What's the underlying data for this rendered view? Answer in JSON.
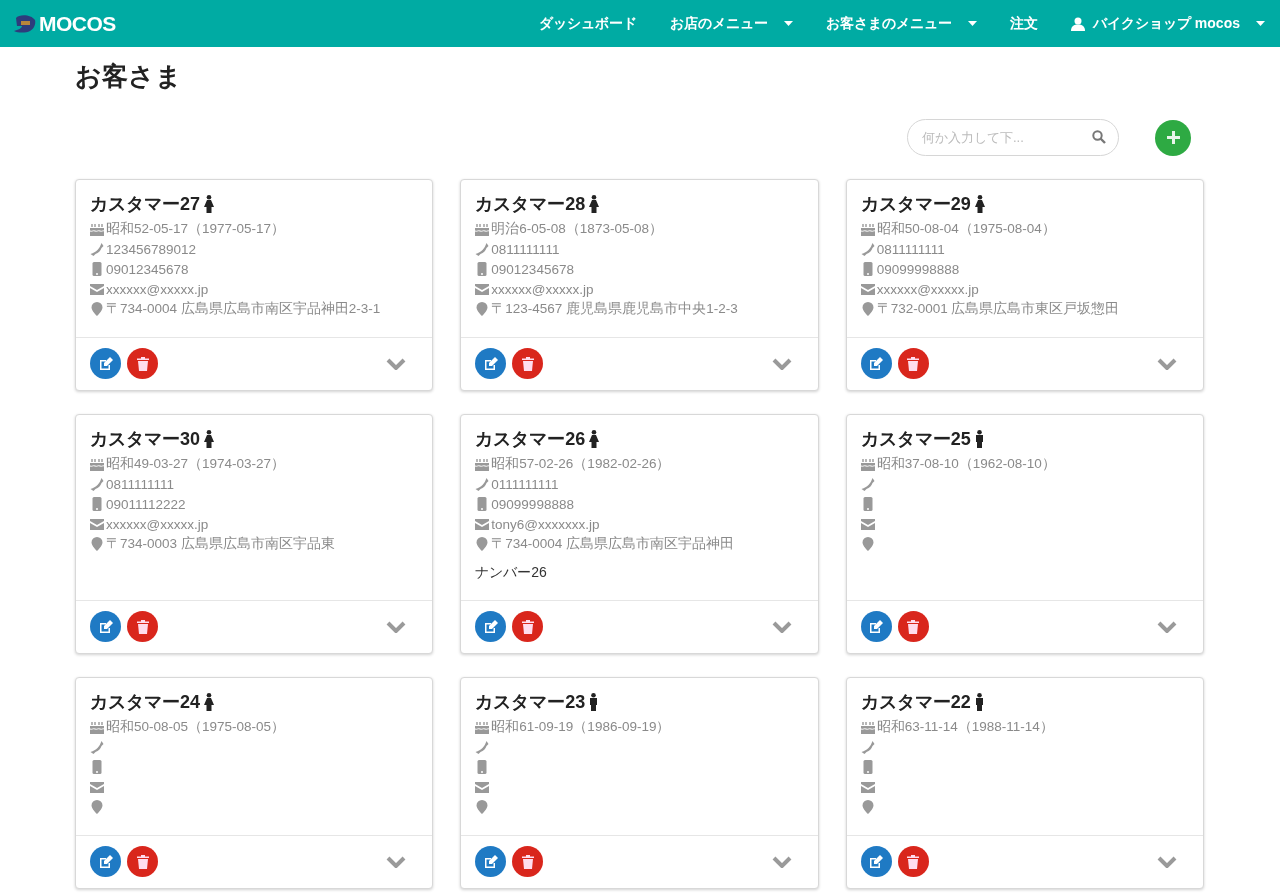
{
  "navbar": {
    "brand": "MOCOS",
    "items": [
      {
        "label": "ダッシュボード",
        "dropdown": false,
        "user": false
      },
      {
        "label": "お店のメニュー",
        "dropdown": true,
        "user": false
      },
      {
        "label": "お客さまのメニュー",
        "dropdown": true,
        "user": false
      },
      {
        "label": "注文",
        "dropdown": false,
        "user": false
      },
      {
        "label": "バイクショップ mocos",
        "dropdown": true,
        "user": true
      }
    ]
  },
  "page_title": "お客さま",
  "search": {
    "placeholder": "何か入力して下..."
  },
  "customers": [
    {
      "name": "カスタマー27",
      "kind": "female",
      "birthday": "昭和52-05-17（1977-05-17）",
      "phone": "123456789012",
      "mobile": "09012345678",
      "email": "xxxxxx@xxxxx.jp",
      "address": "〒734-0004 広島県広島市南区宇品神田2-3-1"
    },
    {
      "name": "カスタマー28",
      "kind": "female",
      "birthday": "明治6-05-08（1873-05-08）",
      "phone": "0811111111",
      "mobile": "09012345678",
      "email": "xxxxxx@xxxxx.jp",
      "address": "〒123-4567 鹿児島県鹿児島市中央1-2-3"
    },
    {
      "name": "カスタマー29",
      "kind": "female",
      "birthday": "昭和50-08-04（1975-08-04）",
      "phone": "0811111111",
      "mobile": "09099998888",
      "email": "xxxxxx@xxxxx.jp",
      "address": "〒732-0001 広島県広島市東区戸坂惣田"
    },
    {
      "name": "カスタマー30",
      "kind": "female",
      "birthday": "昭和49-03-27（1974-03-27）",
      "phone": "0811111111",
      "mobile": "09011112222",
      "email": "xxxxxx@xxxxx.jp",
      "address": "〒734-0003 広島県広島市南区宇品東"
    },
    {
      "name": "カスタマー26",
      "kind": "female",
      "birthday": "昭和57-02-26（1982-02-26）",
      "phone": "0111111111",
      "mobile": "09099998888",
      "email": "tony6@xxxxxxx.jp",
      "address": "〒734-0004 広島県広島市南区宇品神田",
      "note": "ナンバー26"
    },
    {
      "name": "カスタマー25",
      "kind": "male",
      "birthday": "昭和37-08-10（1962-08-10）"
    },
    {
      "name": "カスタマー24",
      "kind": "female",
      "birthday": "昭和50-08-05（1975-08-05）"
    },
    {
      "name": "カスタマー23",
      "kind": "male",
      "birthday": "昭和61-09-19（1986-09-19）"
    },
    {
      "name": "カスタマー22",
      "kind": "male",
      "birthday": "昭和63-11-14（1988-11-14）"
    }
  ]
}
